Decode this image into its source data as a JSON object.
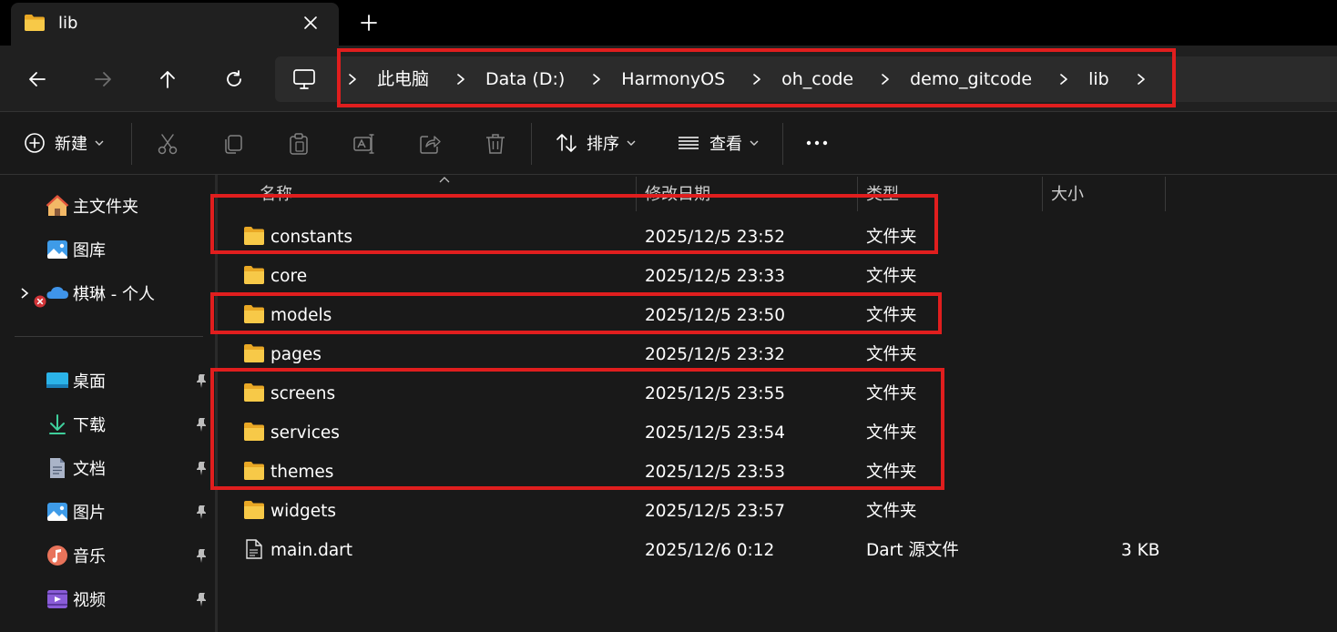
{
  "window": {
    "tab_title": "lib"
  },
  "address": {
    "crumbs": [
      "此电脑",
      "Data (D:)",
      "HarmonyOS",
      "oh_code",
      "demo_gitcode",
      "lib"
    ]
  },
  "toolbar": {
    "new_label": "新建",
    "sort_label": "排序",
    "view_label": "查看"
  },
  "sidebar": {
    "items": [
      {
        "label": "主文件夹",
        "icon": "home-icon"
      },
      {
        "label": "图库",
        "icon": "gallery-icon"
      },
      {
        "label": "棋琳 - 个人",
        "icon": "onedrive-icon"
      },
      {
        "label": "桌面",
        "icon": "desktop-icon",
        "pinned": true
      },
      {
        "label": "下载",
        "icon": "download-icon",
        "pinned": true
      },
      {
        "label": "文档",
        "icon": "document-icon",
        "pinned": true
      },
      {
        "label": "图片",
        "icon": "pictures-icon",
        "pinned": true
      },
      {
        "label": "音乐",
        "icon": "music-icon",
        "pinned": true
      },
      {
        "label": "视频",
        "icon": "video-icon",
        "pinned": true
      }
    ]
  },
  "columns": {
    "name": "名称",
    "date": "修改日期",
    "type": "类型",
    "size": "大小"
  },
  "files": [
    {
      "name": "constants",
      "date": "2025/12/5 23:52",
      "type": "文件夹",
      "size": "",
      "kind": "folder"
    },
    {
      "name": "core",
      "date": "2025/12/5 23:33",
      "type": "文件夹",
      "size": "",
      "kind": "folder"
    },
    {
      "name": "models",
      "date": "2025/12/5 23:50",
      "type": "文件夹",
      "size": "",
      "kind": "folder"
    },
    {
      "name": "pages",
      "date": "2025/12/5 23:32",
      "type": "文件夹",
      "size": "",
      "kind": "folder"
    },
    {
      "name": "screens",
      "date": "2025/12/5 23:55",
      "type": "文件夹",
      "size": "",
      "kind": "folder"
    },
    {
      "name": "services",
      "date": "2025/12/5 23:54",
      "type": "文件夹",
      "size": "",
      "kind": "folder"
    },
    {
      "name": "themes",
      "date": "2025/12/5 23:53",
      "type": "文件夹",
      "size": "",
      "kind": "folder"
    },
    {
      "name": "widgets",
      "date": "2025/12/5 23:57",
      "type": "文件夹",
      "size": "",
      "kind": "folder"
    },
    {
      "name": "main.dart",
      "date": "2025/12/6 0:12",
      "type": "Dart 源文件",
      "size": "3 KB",
      "kind": "file"
    }
  ],
  "colors": {
    "highlight": "#e01e1e",
    "folder": "#f5c342",
    "background": "#191919"
  }
}
